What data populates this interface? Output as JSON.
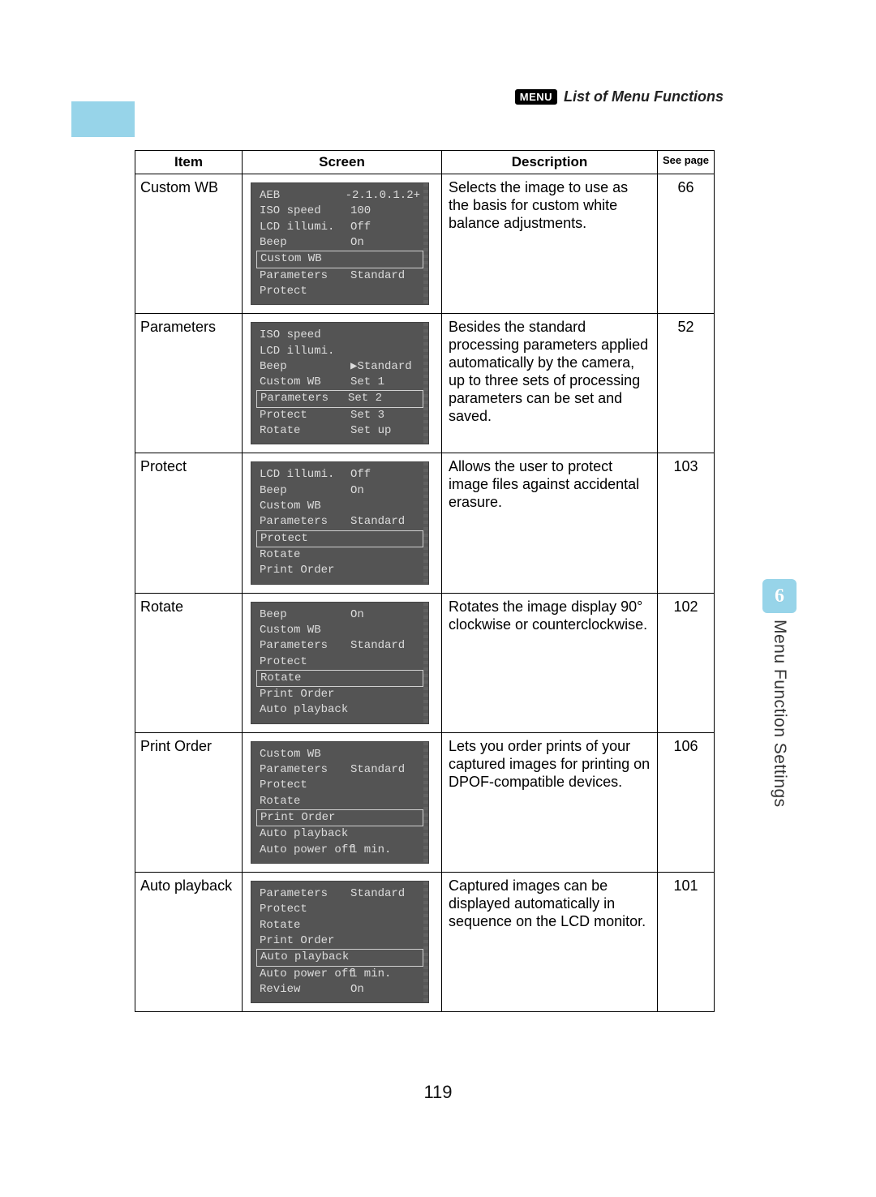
{
  "header": {
    "menu_badge": "MENU",
    "title": "List of Menu Functions"
  },
  "sidetab": {
    "chapter_number": "6",
    "chapter_title": "Menu Function Settings"
  },
  "table": {
    "headers": {
      "item": "Item",
      "screen": "Screen",
      "description": "Description",
      "see_page": "See page"
    },
    "rows": [
      {
        "item": "Custom WB",
        "description": "Selects the image to use as the basis for custom white balance adjustments.",
        "page": "66",
        "screen": {
          "lines": [
            {
              "label": "AEB",
              "value": "-2.1.0.1.2+"
            },
            {
              "label": "ISO speed",
              "value": "100"
            },
            {
              "label": "LCD illumi.",
              "value": "Off"
            },
            {
              "label": "Beep",
              "value": "On"
            },
            {
              "label": "Custom WB",
              "value": "",
              "selected": true
            },
            {
              "label": "Parameters",
              "value": "Standard"
            },
            {
              "label": "Protect",
              "value": ""
            }
          ]
        }
      },
      {
        "item": "Parameters",
        "description": "Besides the standard processing parameters applied automatically by the camera, up to three sets of processing parameters can be set and saved.",
        "page": "52",
        "screen": {
          "pointer_index": 2,
          "lines": [
            {
              "label": "ISO speed",
              "value": ""
            },
            {
              "label": "LCD illumi.",
              "value": ""
            },
            {
              "label": "Beep",
              "value": "▶Standard"
            },
            {
              "label": "Custom WB",
              "value": "Set 1"
            },
            {
              "label": "Parameters",
              "value": "Set 2",
              "selected": true
            },
            {
              "label": "Protect",
              "value": "Set 3"
            },
            {
              "label": "Rotate",
              "value": "Set up"
            }
          ]
        }
      },
      {
        "item": "Protect",
        "description": "Allows the user to protect image files against accidental erasure.",
        "page": "103",
        "screen": {
          "lines": [
            {
              "label": "LCD illumi.",
              "value": "Off"
            },
            {
              "label": "Beep",
              "value": "On"
            },
            {
              "label": "Custom WB",
              "value": ""
            },
            {
              "label": "Parameters",
              "value": "Standard"
            },
            {
              "label": "Protect",
              "value": "",
              "selected": true
            },
            {
              "label": "Rotate",
              "value": ""
            },
            {
              "label": "Print Order",
              "value": ""
            }
          ]
        }
      },
      {
        "item": "Rotate",
        "description": "Rotates the image display 90° clockwise or counterclockwise.",
        "page": "102",
        "screen": {
          "lines": [
            {
              "label": "Beep",
              "value": "On"
            },
            {
              "label": "Custom WB",
              "value": ""
            },
            {
              "label": "Parameters",
              "value": "Standard"
            },
            {
              "label": "Protect",
              "value": ""
            },
            {
              "label": "Rotate",
              "value": "",
              "selected": true
            },
            {
              "label": "Print Order",
              "value": ""
            },
            {
              "label": "Auto playback",
              "value": ""
            }
          ]
        }
      },
      {
        "item": "Print Order",
        "description": "Lets you order prints of your captured images for printing on DPOF-compatible devices.",
        "page": "106",
        "screen": {
          "lines": [
            {
              "label": "Custom WB",
              "value": ""
            },
            {
              "label": "Parameters",
              "value": "Standard"
            },
            {
              "label": "Protect",
              "value": ""
            },
            {
              "label": "Rotate",
              "value": ""
            },
            {
              "label": "Print Order",
              "value": "",
              "selected": true
            },
            {
              "label": "Auto playback",
              "value": ""
            },
            {
              "label": "Auto power off",
              "value": "1 min."
            }
          ]
        }
      },
      {
        "item": "Auto playback",
        "description": "Captured images can be displayed automatically in sequence on the LCD monitor.",
        "page": "101",
        "screen": {
          "lines": [
            {
              "label": "Parameters",
              "value": "Standard"
            },
            {
              "label": "Protect",
              "value": ""
            },
            {
              "label": "Rotate",
              "value": ""
            },
            {
              "label": "Print Order",
              "value": ""
            },
            {
              "label": "Auto playback",
              "value": "",
              "selected": true
            },
            {
              "label": "Auto power off",
              "value": "1 min."
            },
            {
              "label": "Review",
              "value": "On"
            }
          ]
        }
      }
    ]
  },
  "page_number": "119"
}
